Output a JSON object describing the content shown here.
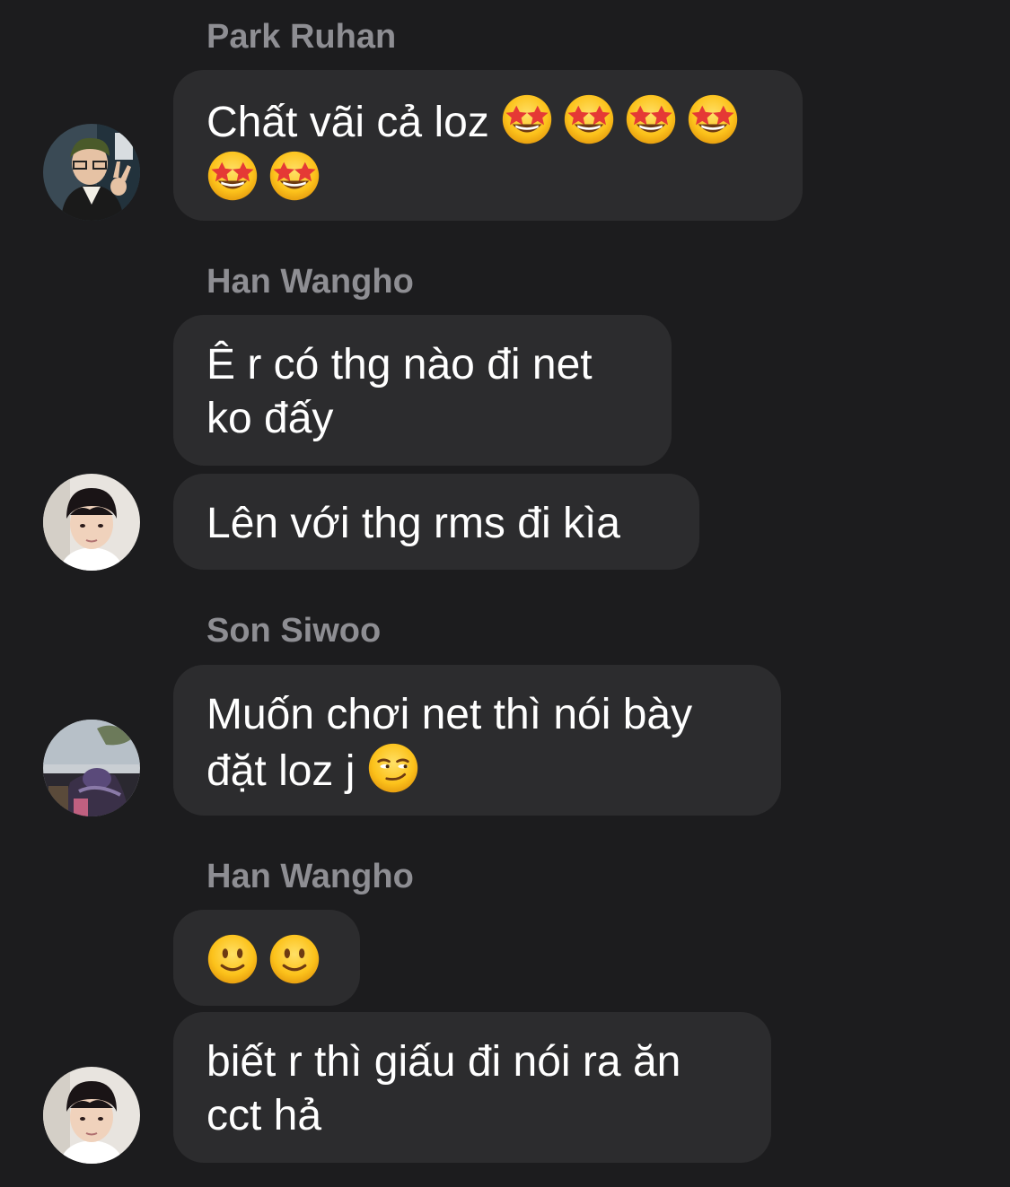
{
  "groups": [
    {
      "sender": "Park Ruhan",
      "messages": [
        {
          "lines": [
            {
              "text": "Chất vãi cả loz ",
              "emojis": [
                "star-struck",
                "star-struck",
                "star-struck",
                "star-struck"
              ]
            },
            {
              "text": "",
              "emojis": [
                "star-struck",
                "star-struck"
              ]
            }
          ]
        }
      ],
      "avatar": "avatar-park-ruhan"
    },
    {
      "sender": "Han Wangho",
      "messages": [
        {
          "lines": [
            {
              "text": "Ê r có thg nào đi net"
            },
            {
              "text": "ko đấy"
            }
          ]
        },
        {
          "lines": [
            {
              "text": "Lên với thg rms đi kìa"
            }
          ]
        }
      ],
      "avatar": "avatar-han-wangho"
    },
    {
      "sender": "Son Siwoo",
      "messages": [
        {
          "lines": [
            {
              "text": "Muốn chơi net thì nói bày"
            },
            {
              "text": "đặt loz  j ",
              "emojis": [
                "smirk"
              ]
            }
          ]
        }
      ],
      "avatar": "avatar-son-siwoo"
    },
    {
      "sender": "Han Wangho",
      "messages": [
        {
          "lines": [
            {
              "text": "",
              "emojis": [
                "slightly-smiling",
                "slightly-smiling"
              ]
            }
          ]
        },
        {
          "lines": [
            {
              "text": "biết r thì giấu đi nói ra ăn"
            },
            {
              "text": "cct hả"
            }
          ]
        }
      ],
      "avatar": "avatar-han-wangho"
    }
  ]
}
